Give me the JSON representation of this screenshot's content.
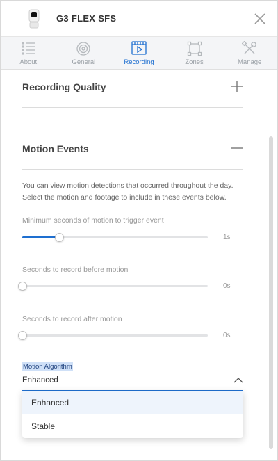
{
  "header": {
    "title": "G3 FLEX SFS"
  },
  "tabs": [
    {
      "label": "About",
      "icon": "list-icon",
      "active": false
    },
    {
      "label": "General",
      "icon": "camera-lens-icon",
      "active": false
    },
    {
      "label": "Recording",
      "icon": "film-icon",
      "active": true
    },
    {
      "label": "Zones",
      "icon": "zones-icon",
      "active": false
    },
    {
      "label": "Manage",
      "icon": "tools-icon",
      "active": false
    }
  ],
  "recording_quality": {
    "title": "Recording Quality"
  },
  "motion_events": {
    "title": "Motion Events",
    "description": "You can view motion detections that occurred throughout the day. Select the motion and footage to include in these events below.",
    "sliders": [
      {
        "label": "Minimum seconds of motion to trigger event",
        "value": "1s",
        "fraction": 0.2
      },
      {
        "label": "Seconds to record before motion",
        "value": "0s",
        "fraction": 0
      },
      {
        "label": "Seconds to record after motion",
        "value": "0s",
        "fraction": 0
      }
    ],
    "algorithm": {
      "label": "Motion Algorithm",
      "selected": "Enhanced",
      "options": [
        "Enhanced",
        "Stable"
      ]
    }
  },
  "colors": {
    "accent": "#1e6fd0",
    "muted": "#999999",
    "track": "#e2e3e5"
  }
}
